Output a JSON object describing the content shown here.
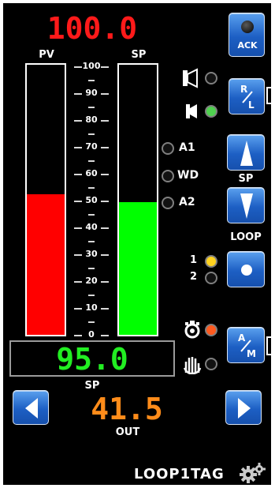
{
  "pv_value": "100.0",
  "pv_label": "PV",
  "sp_label": "SP",
  "scale": {
    "ticks": [
      "100",
      "90",
      "80",
      "70",
      "60",
      "50",
      "40",
      "30",
      "20",
      "10",
      "0"
    ]
  },
  "pv_bar": {
    "level_percent": 52,
    "color": "#ff0000"
  },
  "sp_bar": {
    "level_percent": 49,
    "color": "#00ff00"
  },
  "alarms": {
    "a1": "A1",
    "wd": "WD",
    "a2": "A2"
  },
  "buttons": {
    "ack": "ACK",
    "rl_top": "R",
    "rl_bottom": "L",
    "sp_label": "SP",
    "loop_label": "LOOP",
    "am_top": "A",
    "am_bottom": "M"
  },
  "loops": {
    "loop1": "1",
    "loop2": "2"
  },
  "setpoint_value": "95.0",
  "setpoint_label": "SP",
  "output_value": "41.5",
  "output_label": "OUT",
  "tag": "LOOP1TAG",
  "colors": {
    "pv_text": "#ff1a1a",
    "sp_text": "#22ee22",
    "out_text": "#ff8c1a",
    "button_blue": "#2a6fd6",
    "led_green": "#4fd14f",
    "led_yellow": "#ffd21f",
    "led_orange": "#ff5a1f"
  },
  "icons": {
    "remote": "speaker-outline-icon",
    "local": "speaker-filled-icon",
    "auto": "gear-hand-icon",
    "manual": "hand-icon",
    "settings": "gear-icon",
    "prev": "left-arrow-icon",
    "next": "right-arrow-icon"
  }
}
